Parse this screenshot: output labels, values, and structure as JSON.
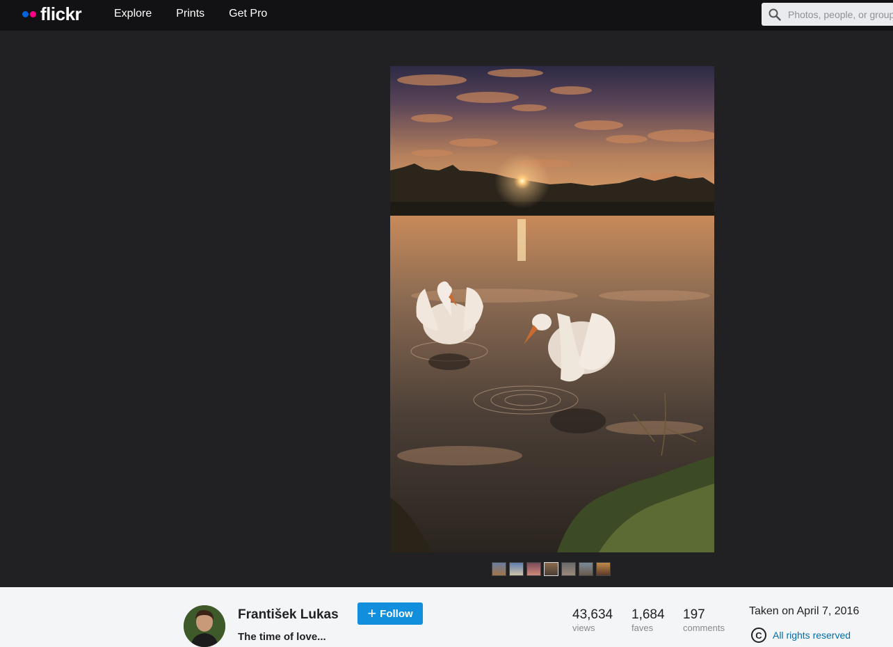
{
  "header": {
    "logo": "flickr",
    "nav": [
      "Explore",
      "Prints",
      "Get Pro"
    ],
    "search_placeholder": "Photos, people, or groups"
  },
  "photo": {
    "alt": "The time of love..."
  },
  "filmstrip": {
    "count": 7,
    "active_index": 3
  },
  "info": {
    "owner": "František Lukas",
    "title": "The time of love...",
    "follow_label": "Follow",
    "stats": {
      "views": {
        "value": "43,634",
        "label": "views"
      },
      "faves": {
        "value": "1,684",
        "label": "faves"
      },
      "comments": {
        "value": "197",
        "label": "comments"
      }
    },
    "taken": "Taken on April 7, 2016",
    "rights": "All rights reserved",
    "rights_symbol": "C"
  },
  "colors": {
    "header_bg": "#121214",
    "page_bg": "#212124",
    "follow_blue": "#128fdc",
    "link_blue": "#006dac",
    "dot_blue": "#0063dc",
    "dot_pink": "#ff0084"
  }
}
